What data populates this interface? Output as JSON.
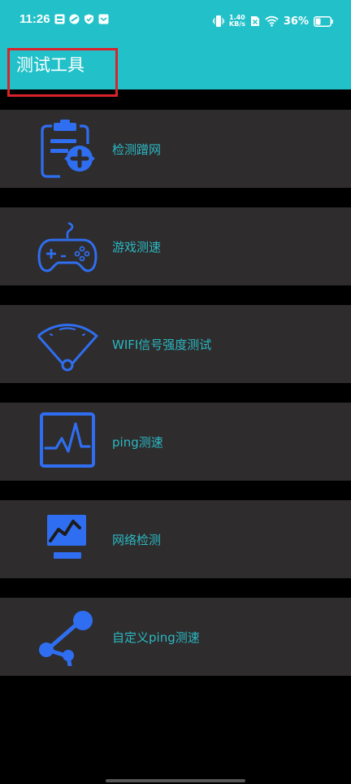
{
  "status_bar": {
    "time": "11:26",
    "net_speed_value": "1.40",
    "net_speed_unit": "KB/s",
    "battery_percent": "36%",
    "icons": [
      "gallery-icon",
      "sync-icon",
      "shield-icon",
      "message-icon",
      "vibrate-icon",
      "no-sim-icon",
      "wifi-icon",
      "battery-icon"
    ]
  },
  "header": {
    "title": "测试工具"
  },
  "menu": {
    "items": [
      {
        "label": "检测蹭网",
        "icon": "clipboard-add-icon"
      },
      {
        "label": "游戏测速",
        "icon": "gamepad-icon"
      },
      {
        "label": "WIFI信号强度测试",
        "icon": "wifi-signal-icon"
      },
      {
        "label": "ping测速",
        "icon": "pulse-monitor-icon"
      },
      {
        "label": "网络检测",
        "icon": "monitor-chart-icon"
      },
      {
        "label": "自定义ping测速",
        "icon": "share-nodes-icon"
      }
    ]
  },
  "colors": {
    "header_bg": "#22c1c9",
    "item_bg": "#2e2c2c",
    "label": "#2bb8c4",
    "icon_blue": "#2f6ef0",
    "highlight": "#d8232a"
  }
}
